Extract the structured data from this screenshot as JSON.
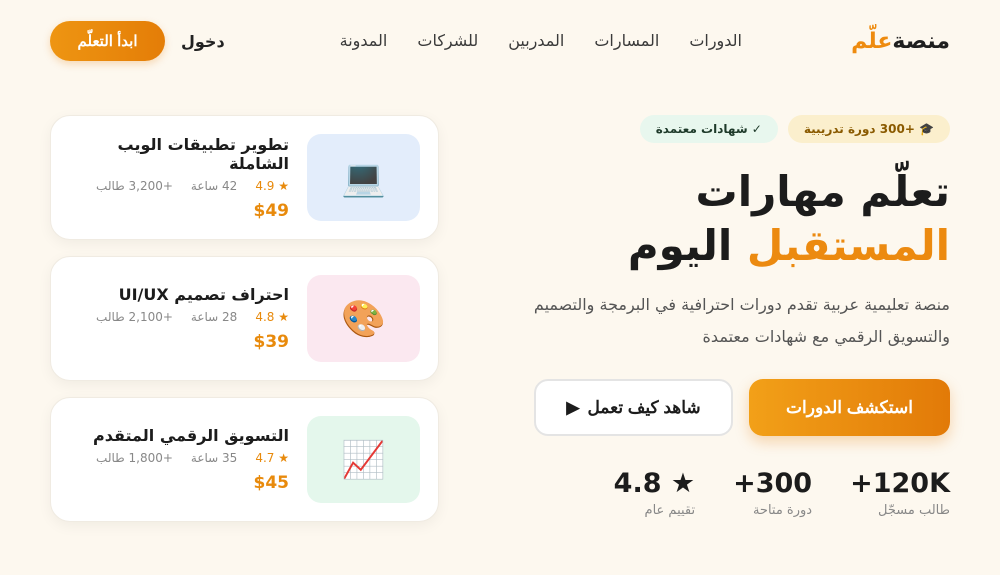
{
  "nav": {
    "logo_main": "منصة",
    "logo_accent": "علّم",
    "links": [
      "الدورات",
      "المسارات",
      "المدربين",
      "للشركات",
      "المدونة"
    ],
    "login": "دخول",
    "start_button": "ابدأ التعلّم"
  },
  "hero": {
    "badge_courses": "🎓 +300 دورة تدريبية",
    "badge_certs": "✓ شهادات معتمدة",
    "headline_line1": "تعلّم مهارات",
    "headline_accent": "المستقبل",
    "headline_rest": "اليوم",
    "description": "منصة تعليمية عربية تقدم دورات احترافية في البرمجة والتصميم والتسويق الرقمي مع شهادات معتمدة",
    "explore_button": "استكشف الدورات",
    "watch_button": "شاهد كيف تعمل",
    "watch_icon": "▶"
  },
  "stats": [
    {
      "value": "+120K",
      "label": "طالب مسجّل"
    },
    {
      "value": "+300",
      "label": "دورة متاحة"
    },
    {
      "value": "4.8 ★",
      "label": "تقييم عام"
    }
  ],
  "courses": [
    {
      "title": "تطوير تطبيقات الويب الشاملة",
      "rating": "★ 4.9",
      "hours": "42 ساعة",
      "students": "+3,200 طالب",
      "price": "$49",
      "icon": "💻",
      "icon_name": "laptop-icon",
      "thumb_color": "#e3edfb"
    },
    {
      "title": "احتراف تصميم UI/UX",
      "rating": "★ 4.8",
      "hours": "28 ساعة",
      "students": "+2,100 طالب",
      "price": "$39",
      "icon": "🎨",
      "icon_name": "palette-icon",
      "thumb_color": "#fbe8f0"
    },
    {
      "title": "التسويق الرقمي المتقدم",
      "rating": "★ 4.7",
      "hours": "35 ساعة",
      "students": "+1,800 طالب",
      "price": "$45",
      "icon": "📈",
      "icon_name": "chart-icon",
      "thumb_color": "#e4f7ec"
    }
  ],
  "colors": {
    "accent": "#ee8b0f",
    "background": "#fdf8ef"
  }
}
